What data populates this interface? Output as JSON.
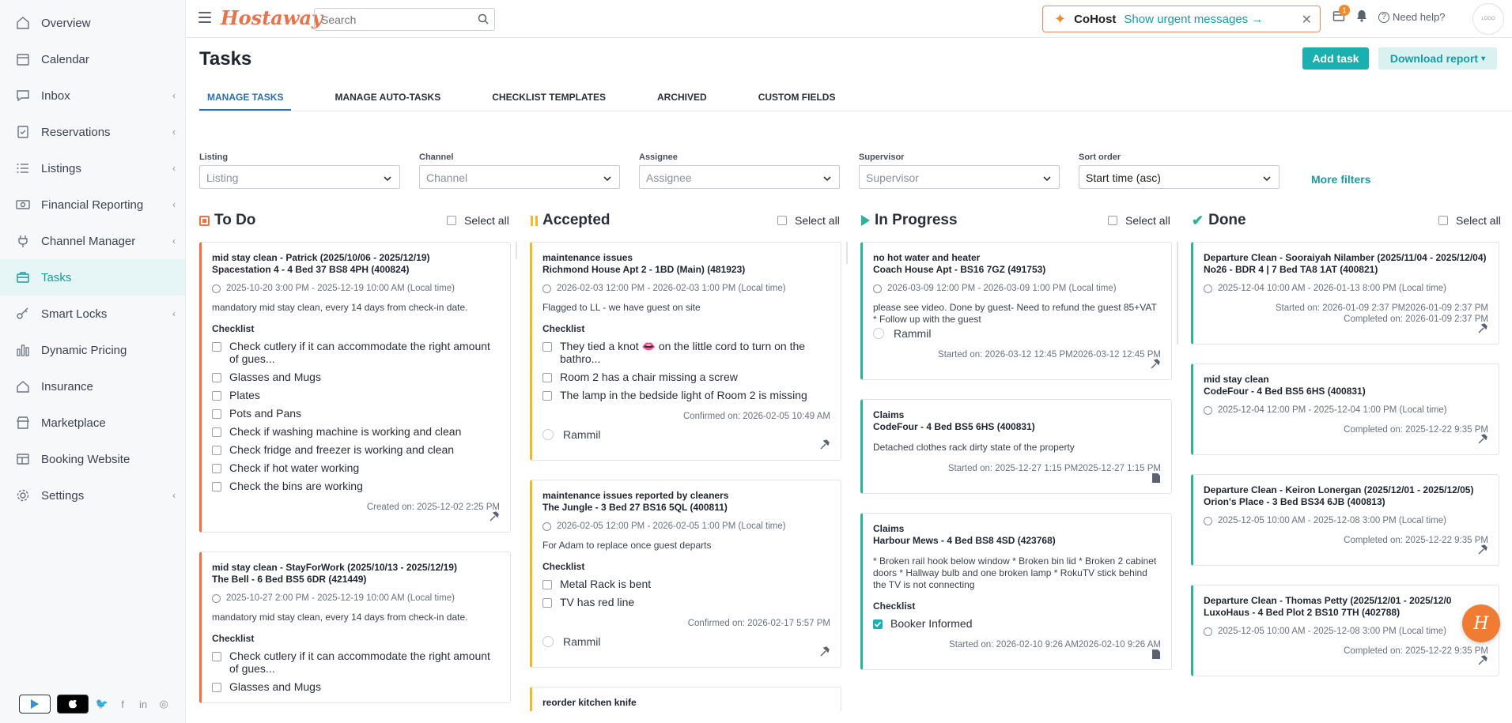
{
  "sidebar": {
    "items": [
      {
        "label": "Overview",
        "icon": "home-icon",
        "chevron": false,
        "active": false
      },
      {
        "label": "Calendar",
        "icon": "calendar-icon",
        "chevron": false,
        "active": false
      },
      {
        "label": "Inbox",
        "icon": "chat-icon",
        "chevron": true,
        "active": false
      },
      {
        "label": "Reservations",
        "icon": "reservation-icon",
        "chevron": true,
        "active": false
      },
      {
        "label": "Listings",
        "icon": "list-icon",
        "chevron": true,
        "active": false
      },
      {
        "label": "Financial Reporting",
        "icon": "money-icon",
        "chevron": true,
        "active": false
      },
      {
        "label": "Channel Manager",
        "icon": "plug-icon",
        "chevron": true,
        "active": false
      },
      {
        "label": "Tasks",
        "icon": "briefcase-icon",
        "chevron": false,
        "active": true
      },
      {
        "label": "Smart Locks",
        "icon": "key-icon",
        "chevron": true,
        "active": false
      },
      {
        "label": "Dynamic Pricing",
        "icon": "bar-chart-icon",
        "chevron": false,
        "active": false
      },
      {
        "label": "Insurance",
        "icon": "house-shield-icon",
        "chevron": false,
        "active": false
      },
      {
        "label": "Marketplace",
        "icon": "store-icon",
        "chevron": false,
        "active": false
      },
      {
        "label": "Booking Website",
        "icon": "browser-icon",
        "chevron": false,
        "active": false
      },
      {
        "label": "Settings",
        "icon": "gear-icon",
        "chevron": true,
        "active": false
      }
    ]
  },
  "header": {
    "logo": "Hostaway",
    "search_placeholder": "Search",
    "cohost_name": "CoHost",
    "cohost_link": "Show urgent messages →",
    "notif_count": "1",
    "help": "Need help?"
  },
  "page": {
    "title": "Tasks",
    "add_task": "Add task",
    "download_report": "Download report"
  },
  "tabs": [
    "MANAGE TASKS",
    "MANAGE AUTO-TASKS",
    "CHECKLIST TEMPLATES",
    "ARCHIVED",
    "CUSTOM FIELDS"
  ],
  "filters": [
    {
      "label": "Listing",
      "placeholder": "Listing"
    },
    {
      "label": "Channel",
      "placeholder": "Channel"
    },
    {
      "label": "Assignee",
      "placeholder": "Assignee"
    },
    {
      "label": "Supervisor",
      "placeholder": "Supervisor"
    },
    {
      "label": "Sort order",
      "value": "Start time (asc)"
    }
  ],
  "more_filters": "More filters",
  "select_all": "Select all",
  "columns": {
    "todo": {
      "title": "To Do",
      "color": "#f0713e",
      "cards": [
        {
          "title": "mid stay clean - Patrick (2025/10/06 - 2025/12/19)",
          "subtitle": "Spacestation 4 - 4 Bed 37 BS8 4PH (400824)",
          "time": "2025-10-20 3:00 PM - 2025-12-19 10:00 AM (Local time)",
          "desc": "mandatory mid stay clean, every 14 days from check-in date.",
          "checklist_label": "Checklist",
          "checklist": [
            "Check cutlery if it can accommodate the right amount of gues...",
            "Glasses and Mugs",
            "Plates",
            "Pots and Pans",
            "Check if washing machine is working and clean",
            "Check fridge and freezer is working and clean",
            "Check if hot water working",
            "Check the bins are working"
          ],
          "meta": "Created on: 2025-12-02 2:25 PM"
        },
        {
          "title": "mid stay clean - StayForWork (2025/10/13 - 2025/12/19)",
          "subtitle": "The Bell - 6 Bed BS5 6DR (421449)",
          "time": "2025-10-27 2:00 PM - 2025-12-19 10:00 AM (Local time)",
          "desc": "mandatory mid stay clean, every 14 days from check-in date.",
          "checklist_label": "Checklist",
          "checklist": [
            "Check cutlery if it can accommodate the right amount of gues...",
            "Glasses and Mugs"
          ],
          "meta": ""
        }
      ]
    },
    "accepted": {
      "title": "Accepted",
      "color": "#f5b62a",
      "cards": [
        {
          "title": "maintenance issues",
          "subtitle": "Richmond House Apt 2 - 1BD (Main) (481923)",
          "time": "2026-02-03 12:00 PM - 2026-02-03 1:00 PM (Local time)",
          "desc": "Flagged to LL - we have guest on site",
          "checklist_label": "Checklist",
          "checklist": [
            "They tied a knot 👄 on the little cord to turn on the bathro...",
            "Room 2 has a chair missing a screw",
            "The lamp in the bedside light of Room 2 is missing"
          ],
          "meta": "Confirmed on: 2026-02-05 10:49 AM",
          "assignee": "Rammil"
        },
        {
          "title": "maintenance issues reported by cleaners",
          "subtitle": "The Jungle - 3 Bed 27 BS16 5QL (400811)",
          "time": "2026-02-05 12:00 PM - 2026-02-05 1:00 PM (Local time)",
          "desc": "For Adam to replace once guest departs",
          "checklist_label": "Checklist",
          "checklist": [
            "Metal Rack is bent",
            "TV has red line"
          ],
          "meta": "Confirmed on: 2026-02-17 5:57 PM",
          "assignee": "Rammil"
        },
        {
          "title": "reorder kitchen knife",
          "subtitle": "",
          "time": "",
          "desc": "",
          "checklist_label": "",
          "checklist": [],
          "meta": ""
        }
      ]
    },
    "inprogress": {
      "title": "In Progress",
      "color": "#2bb39a",
      "cards": [
        {
          "title": "no hot water and heater",
          "subtitle": "Coach House Apt - BS16 7GZ (491753)",
          "time": "2026-03-09 12:00 PM - 2026-03-09 1:00 PM (Local time)",
          "desc": "please see video. Done by guest- Need to refund the guest 85+VAT * Follow up with the guest",
          "assignee": "Rammil",
          "meta": "Started on: 2026-03-12 12:45 PM2026-03-12 12:45 PM"
        },
        {
          "title": "Claims",
          "subtitle": "CodeFour - 4 Bed BS5 6HS (400831)",
          "desc": "Detached clothes rack dirty state of the property",
          "meta": "Started on: 2025-12-27 1:15 PM2025-12-27 1:15 PM"
        },
        {
          "title": "Claims",
          "subtitle": "Harbour Mews - 4 Bed BS8 4SD (423768)",
          "desc": "* Broken rail hook below window * Broken bin lid * Broken 2 cabinet doors * Hallway bulb and one broken lamp * RokuTV stick behind the TV is not connecting",
          "checklist_label": "Checklist",
          "checklist_checked": "Booker Informed",
          "meta": "Started on: 2026-02-10 9:26 AM2026-02-10 9:26 AM"
        }
      ]
    },
    "done": {
      "title": "Done",
      "color": "#2bb39a",
      "cards": [
        {
          "title": "Departure Clean - Sooraiyah Nilamber (2025/11/04 - 2025/12/04)",
          "subtitle": "No26 - BDR 4 | 7 Bed TA8 1AT (400821)",
          "time": "2025-12-04 10:00 AM - 2026-01-13 8:00 PM (Local time)",
          "meta1": "Started on: 2026-01-09 2:37 PM2026-01-09 2:37 PM",
          "meta2": "Completed on: 2026-01-09 2:37 PM"
        },
        {
          "title": "mid stay clean",
          "subtitle": "CodeFour - 4 Bed BS5 6HS (400831)",
          "time": "2025-12-04 12:00 PM - 2025-12-04 1:00 PM (Local time)",
          "meta2": "Completed on: 2025-12-22 9:35 PM"
        },
        {
          "title": "Departure Clean - Keiron Lonergan (2025/12/01 - 2025/12/05)",
          "subtitle": "Orion's Place - 3 Bed BS34 6JB (400813)",
          "time": "2025-12-05 10:00 AM - 2025-12-08 3:00 PM (Local time)",
          "meta2": "Completed on: 2025-12-22 9:35 PM"
        },
        {
          "title": "Departure Clean - Thomas Petty (2025/12/01 - 2025/12/0",
          "subtitle": "LuxoHaus - 4 Bed Plot 2 BS10 7TH (402788)",
          "time": "2025-12-05 10:00 AM - 2025-12-08 3:00 PM (Local time)",
          "meta2": "Completed on: 2025-12-22 9:35 PM"
        }
      ]
    }
  }
}
